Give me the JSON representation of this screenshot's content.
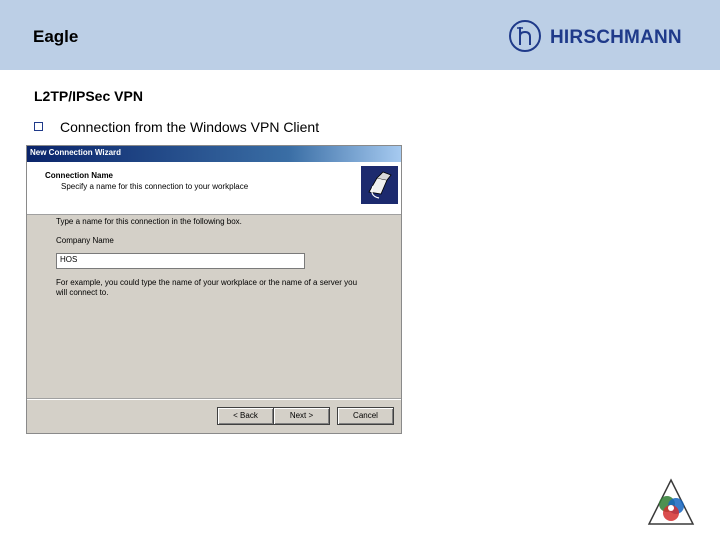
{
  "header": {
    "title": "Eagle",
    "brand": "HIRSCHMANN",
    "bg_color": "#bccfe6",
    "brand_color": "#1f3a8a"
  },
  "slide": {
    "title": "L2TP/IPSec VPN",
    "bullet": "Connection from the Windows VPN Client"
  },
  "wizard": {
    "window_title": "New Connection Wizard",
    "heading": "Connection Name",
    "subheading": "Specify a name for this connection to your workplace",
    "instruction": "Type a name for this connection in the following box.",
    "field_label": "Company Name",
    "field_value": "HOS",
    "example": "For example, you could type the name of your workplace or the name of a server you will connect to.",
    "buttons": {
      "back": "< Back",
      "next": "Next >",
      "cancel": "Cancel"
    },
    "icon": "network-connection-icon"
  },
  "footer": {
    "logo_icon": "color-triangle-logo-icon"
  }
}
